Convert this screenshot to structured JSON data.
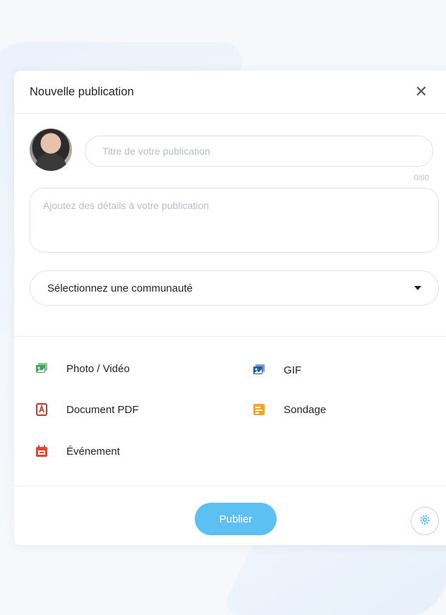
{
  "modal": {
    "title": "Nouvelle publication",
    "close_glyph": "✕",
    "title_placeholder": "Titre de votre publication",
    "title_counter": "0/60",
    "details_placeholder": "Ajoutez des détails à votre publication",
    "community_select": "Sélectionnez une communauté",
    "options": [
      {
        "label": "Photo / Vidéo",
        "icon": "photo-video-icon",
        "color": "#34a853"
      },
      {
        "label": "GIF",
        "icon": "gif-icon",
        "color": "#1a5fb4"
      },
      {
        "label": "Document PDF",
        "icon": "pdf-icon",
        "color": "#c0392b"
      },
      {
        "label": "Sondage",
        "icon": "poll-icon",
        "color": "#f5a623"
      },
      {
        "label": "Événement",
        "icon": "calendar-icon",
        "color": "#e8442b"
      }
    ],
    "publish_label": "Publier",
    "accent_color": "#5cc1f2"
  }
}
